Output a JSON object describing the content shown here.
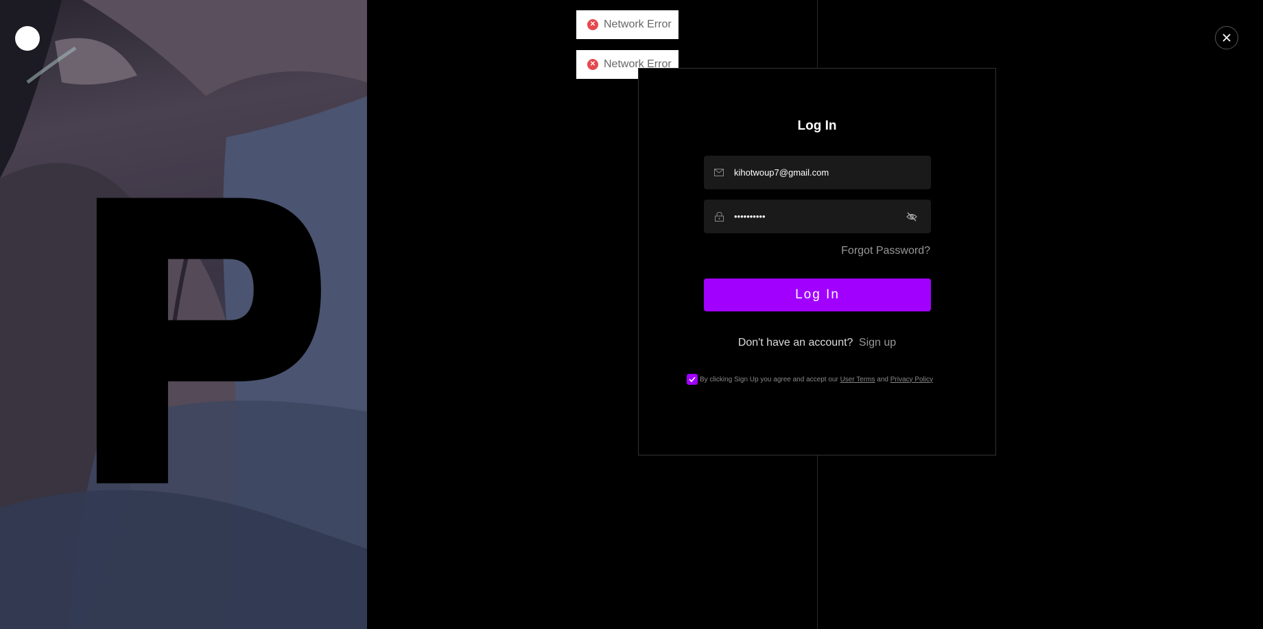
{
  "toasts": [
    {
      "icon": "error-icon",
      "text": "Network Error"
    },
    {
      "icon": "error-icon",
      "text": "Network Error"
    }
  ],
  "login": {
    "title": "Log In",
    "email_value": "kihotwoup7@gmail.com",
    "password_value": "••••••••••",
    "forgot_label": "Forgot Password?",
    "submit_label": "Log In",
    "no_account_text": "Don't have an account?",
    "signup_label": "Sign up",
    "terms_prefix": "By clicking Sign Up you agree and accept our",
    "user_terms_label": "User Terms",
    "and_text": "and",
    "privacy_label": "Privacy Policy",
    "terms_checked": true
  },
  "colors": {
    "accent": "#a100ff",
    "error": "#e5484d",
    "field_bg": "#1a1a1a"
  },
  "icons": {
    "logo": "brand-logo-icon",
    "close": "close-icon",
    "email": "mail-icon",
    "password": "lock-icon",
    "visibility": "eye-off-icon",
    "checkbox": "checkmark-icon"
  }
}
